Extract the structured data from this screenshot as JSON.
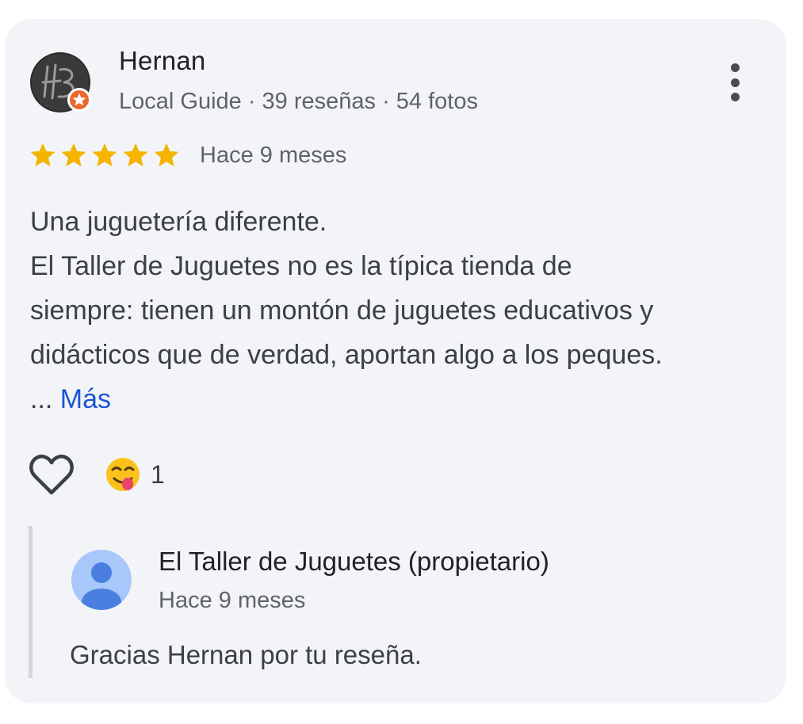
{
  "review": {
    "reviewer_name": "Hernan",
    "reviewer_meta": "Local Guide · 39 reseñas · 54 fotos",
    "rating": 5,
    "date": "Hace 9 meses",
    "body_lines": [
      "Una juguetería diferente.",
      "El Taller de Juguetes no es la típica tienda de",
      "siempre: tienen un montón de juguetes educativos y",
      "didácticos que de verdad, aportan algo a los peques."
    ],
    "ellipsis": "...",
    "more_label": "Más",
    "reaction_emoji": "😋",
    "reaction_count": "1"
  },
  "owner_reply": {
    "name": "El Taller de Juguetes (propietario)",
    "date": "Hace 9 meses",
    "text": "Gracias Hernan por tu reseña."
  },
  "icons": {
    "reviewer_avatar": "monogram-avatar-icon",
    "local_guide_badge": "local-guide-star-badge-icon",
    "more_options": "more-vert-icon",
    "star": "star-icon",
    "like": "heart-outline-icon",
    "owner_avatar": "person-avatar-icon"
  },
  "colors": {
    "card_background": "#f3f4f7",
    "star": "#f4b400",
    "link": "#1a56d6",
    "badge": "#e8692e",
    "owner_avatar_bg": "#a8c7fa",
    "owner_avatar_fg": "#4a7fe0"
  }
}
